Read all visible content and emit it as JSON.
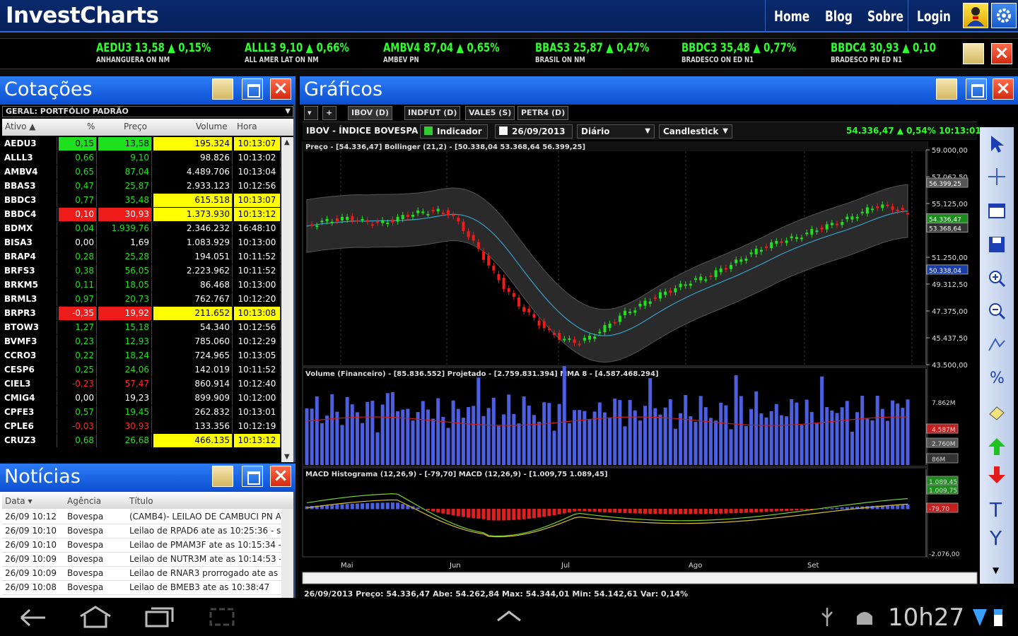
{
  "app": {
    "title": "InvestCharts"
  },
  "nav": {
    "home": "Home",
    "blog": "Blog",
    "about": "Sobre",
    "login": "Login"
  },
  "ticker": [
    {
      "l1": "AEDU3  13,58 ▲ 0,15%",
      "l2": "ANHANGUERA ON NM"
    },
    {
      "l1": "ALLL3  9,10 ▲ 0,66%",
      "l2": "ALL AMER LAT ON NM"
    },
    {
      "l1": "AMBV4  87,04 ▲ 0,65%",
      "l2": "AMBEV PN"
    },
    {
      "l1": "BBAS3  25,87 ▲ 0,47%",
      "l2": "BRASIL ON NM"
    },
    {
      "l1": "BBDC3  35,48 ▲ 0,77%",
      "l2": "BRADESCO ON ED N1"
    },
    {
      "l1": "BBDC4  30,93 ▲ 0,10",
      "l2": "BRADESCO PN ED N1"
    }
  ],
  "quotes": {
    "title": "Cotações",
    "portfolio": "GERAL: PORTFÓLIO PADRÃO",
    "headers": [
      "Ativo ▲",
      "%",
      "Preço",
      "Volume",
      "Hora"
    ],
    "rows": [
      [
        "AEDU3",
        "0,15",
        "13,58",
        "195.324",
        "10:13:07"
      ],
      [
        "ALLL3",
        "0,66",
        "9,10",
        "98.826",
        "10:13:02"
      ],
      [
        "AMBV4",
        "0,65",
        "87,04",
        "4.489.706",
        "10:13:04"
      ],
      [
        "BBAS3",
        "0,47",
        "25,87",
        "2.933.123",
        "10:12:56"
      ],
      [
        "BBDC3",
        "0,77",
        "35,48",
        "615.518",
        "10:13:07"
      ],
      [
        "BBDC4",
        "0,10",
        "30,93",
        "1.373.930",
        "10:13:12"
      ],
      [
        "BDMX",
        "0,04",
        "1.939,76",
        "2.346.232",
        "16:48:10"
      ],
      [
        "BISA3",
        "0,00",
        "1,69",
        "1.083.929",
        "10:13:00"
      ],
      [
        "BRAP4",
        "0,28",
        "25,28",
        "194.051",
        "10:11:52"
      ],
      [
        "BRFS3",
        "0,38",
        "56,05",
        "2.223.962",
        "10:11:52"
      ],
      [
        "BRKM5",
        "0,11",
        "18,05",
        "86.468",
        "10:13:00"
      ],
      [
        "BRML3",
        "0,97",
        "20,73",
        "762.767",
        "10:12:20"
      ],
      [
        "BRPR3",
        "-0,35",
        "19,92",
        "211.652",
        "10:13:08"
      ],
      [
        "BTOW3",
        "1,27",
        "15,18",
        "54.340",
        "10:12:56"
      ],
      [
        "BVMF3",
        "0,23",
        "12,93",
        "785.060",
        "10:12:29"
      ],
      [
        "CCRO3",
        "0,22",
        "18,24",
        "724.965",
        "10:13:05"
      ],
      [
        "CESP6",
        "0,25",
        "24,06",
        "142.019",
        "10:11:52"
      ],
      [
        "CIEL3",
        "-0,23",
        "57,47",
        "860.914",
        "10:12:40"
      ],
      [
        "CMIG4",
        "0,00",
        "19,23",
        "899.909",
        "10:12:00"
      ],
      [
        "CPFE3",
        "0,57",
        "19,45",
        "262.832",
        "10:13:01"
      ],
      [
        "CPLE6",
        "-0,03",
        "30,93",
        "133.356",
        "10:12:19"
      ],
      [
        "CRUZ3",
        "0,68",
        "26,68",
        "466.135",
        "10:13:12"
      ]
    ]
  },
  "news": {
    "title": "Notícias",
    "headers": [
      "Data ▾",
      "Agência",
      "Título"
    ],
    "rows": [
      [
        "26/09  10:12",
        "Bovespa",
        "(CAMB4)- LEILAO DE CAMBUCI PN A"
      ],
      [
        "26/09  10:10",
        "Bovespa",
        "Leilao de RPAD6 ate as 10:25:36 - se"
      ],
      [
        "26/09  10:10",
        "Bovespa",
        "Leilao de PMAM3F ate as 10:15:34 -"
      ],
      [
        "26/09  10:09",
        "Bovespa",
        "Leilao de NUTR3M ate as 10:14:53 -"
      ],
      [
        "26/09  10:09",
        "Bovespa",
        "Leilao de RNAR3 prorrogado ate as"
      ],
      [
        "26/09  10:08",
        "Bovespa",
        "Leilao de BMEB3 ate as 10:38:47"
      ]
    ]
  },
  "charts": {
    "title": "Gráficos",
    "tabs": [
      "IBOV (D)",
      "INDFUT (D)",
      "VALE5 (S)",
      "PETR4 (D)"
    ],
    "symbol": "IBOV - ÍNDICE BOVESPA",
    "indicator": "Indicador",
    "date": "26/09/2013",
    "period": "Diário",
    "type": "Candlestick",
    "quote": "54.336,47 ▲ 0,54%  10:13:01",
    "price_caption": "Preço - [54.336,47]   Bollinger (21,2) - [50.338,04  53.368,64  56.399,25]",
    "volume_caption": "Volume (Financeiro) - [85.836.552]   Projetado - [2.759.831.394]   MMA 8 - [4.587.468.294]",
    "macd_caption": "MACD Histograma (12,26,9) - [-79,70]   MACD (12,26,9) - [1.009,75  1.089,45]",
    "price_ticks": [
      "59.000,00",
      "57.062,50",
      "55.125,00",
      "51.250,00",
      "49.312,50",
      "47.375,00",
      "45.437,50",
      "43.500,00"
    ],
    "price_tags": [
      "56.399,25",
      "54.336,47",
      "53.368,64",
      "50.338,04"
    ],
    "volume_ticks": [
      "7.862M",
      "4.587M",
      "2.760M",
      "86M"
    ],
    "macd_ticks": [
      "1.089,45",
      "1.009,75",
      "-79,70",
      "-2.076,00"
    ],
    "months": [
      "Mai",
      "Jun",
      "Jul",
      "Ago",
      "Set"
    ],
    "info": "26/09/2013   Preço: 54.336,47   Abe: 54.262,84   Max: 54.344,01   Min: 54.142,61   Var: 0,14%"
  },
  "chart_data": {
    "type": "candlestick",
    "x": [
      "Mai",
      "Jun",
      "Jul",
      "Ago",
      "Set"
    ],
    "ylim": [
      43500,
      59000
    ],
    "close_path": [
      53500,
      53800,
      53950,
      54100,
      53800,
      53700,
      53900,
      54300,
      54500,
      54600,
      54400,
      53200,
      51800,
      50200,
      48800,
      47600,
      46700,
      45800,
      45300,
      45100,
      45600,
      46300,
      47100,
      47600,
      48200,
      48700,
      49100,
      49600,
      49800,
      50400,
      50900,
      51500,
      52000,
      52400,
      52600,
      53000,
      53400,
      53700,
      54100,
      54600,
      55000,
      54800,
      54336
    ]
  },
  "statusbar": {
    "clock": "10h27"
  },
  "colors": {
    "up": "#22e022",
    "down": "#ee1b1b",
    "accent": "#1b5fd6",
    "highlight": "#ffff00"
  }
}
